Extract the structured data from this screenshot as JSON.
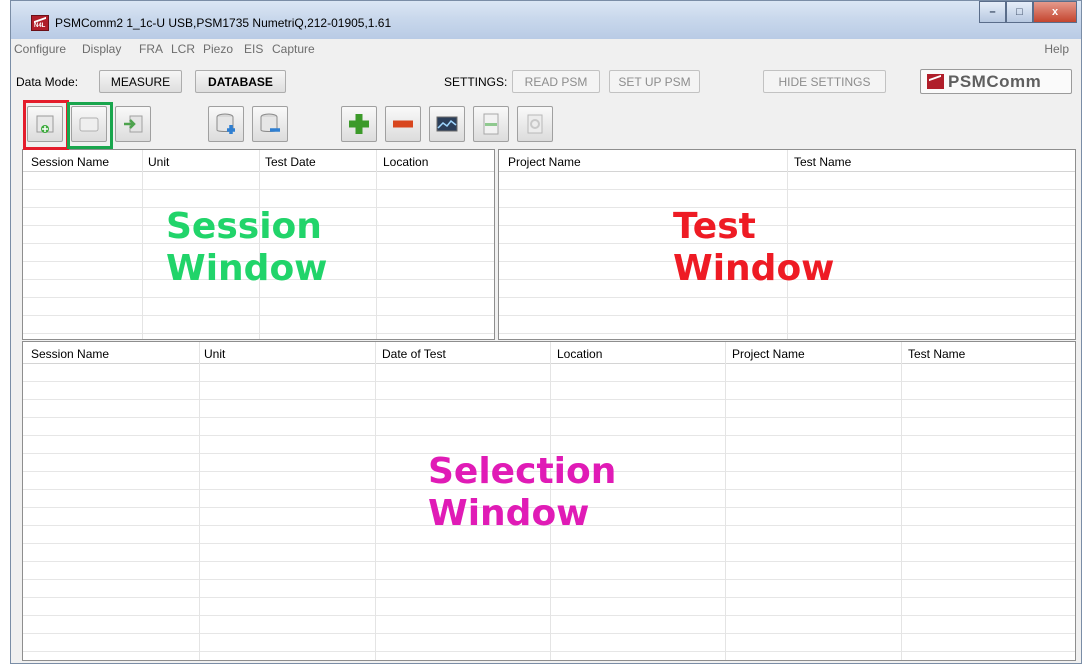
{
  "window": {
    "title": "PSMComm2 1_1c-U    USB,PSM1735 NumetriQ,212-01905,1.61",
    "controls": {
      "minimize": "–",
      "maximize": "□",
      "close": "x"
    }
  },
  "menu": {
    "items": [
      "Configure",
      "Display",
      "FRA",
      "LCR",
      "Piezo",
      "EIS",
      "Capture"
    ],
    "help": "Help"
  },
  "mode_bar": {
    "data_mode_label": "Data Mode:",
    "measure": "MEASURE",
    "database": "DATABASE",
    "settings_label": "SETTINGS:",
    "read_psm": "READ PSM",
    "set_up_psm": "SET UP PSM",
    "hide_settings": "HIDE SETTINGS",
    "logo": "PSMComm"
  },
  "toolbar": {
    "icons": [
      "new-session-icon",
      "open-session-icon",
      "export-session-icon",
      "add-database-icon",
      "remove-database-icon",
      "add-icon",
      "remove-icon",
      "graph-icon",
      "document-icon",
      "delete-icon"
    ]
  },
  "session_window": {
    "columns": [
      "Session Name",
      "Unit",
      "Test Date",
      "Location"
    ],
    "overlay": [
      "Session",
      "Window"
    ],
    "overlay_color": "#21d46a"
  },
  "test_window": {
    "columns": [
      "Project Name",
      "Test Name"
    ],
    "overlay": [
      "Test",
      "Window"
    ],
    "overlay_color": "#ee1b24"
  },
  "selection_window": {
    "columns": [
      "Session Name",
      "Unit",
      "Date of Test",
      "Location",
      "Project Name",
      "Test Name"
    ],
    "overlay": [
      "Selection",
      "Window"
    ],
    "overlay_color": "#e01bb6"
  },
  "colors": {
    "highlight_new": "#e41d2c",
    "highlight_open": "#19a64d",
    "brand": "#b01e2a"
  }
}
